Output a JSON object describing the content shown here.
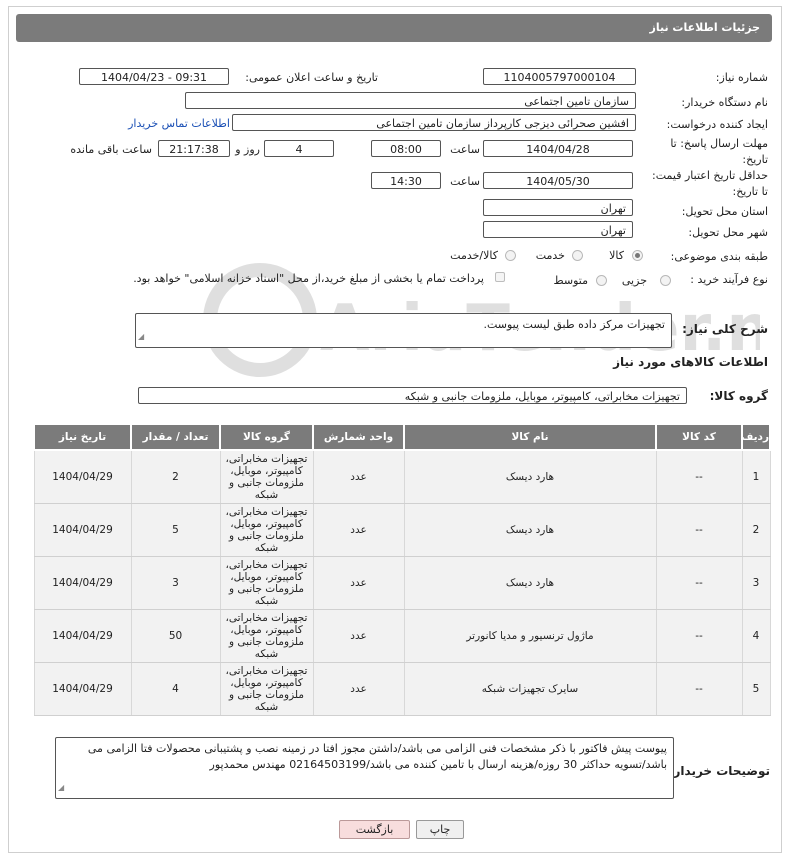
{
  "header": {
    "title": "جزئیات اطلاعات نیاز"
  },
  "form": {
    "need_number_label": "شماره نیاز:",
    "need_number": "1104005797000104",
    "announce_label": "تاریخ و ساعت اعلان عمومی:",
    "announce_value": "1404/04/23 - 09:31",
    "buyer_org_label": "نام دستگاه خریدار:",
    "buyer_org": "سازمان تامین اجتماعی",
    "creator_label": "ایجاد کننده درخواست:",
    "creator": "افشین صحرائی دیزجی کارپرداز سازمان تامین اجتماعی",
    "contact_link": "اطلاعات تماس خریدار",
    "deadline_label": "مهلت ارسال پاسخ: تا تاریخ:",
    "deadline_date": "1404/04/28",
    "time_label": "ساعت",
    "deadline_time": "08:00",
    "days_value": "4",
    "days_label": "روز و",
    "remaining_time": "21:17:38",
    "remaining_label": "ساعت باقی مانده",
    "validity_label": "حداقل تاریخ اعتبار قیمت: تا تاریخ:",
    "validity_date": "1404/05/30",
    "validity_time": "14:30",
    "province_label": "استان محل تحویل:",
    "province": "تهران",
    "city_label": "شهر محل تحویل:",
    "city": "تهران",
    "category_label": "طبقه بندی موضوعی:",
    "category_options": [
      "کالا",
      "خدمت",
      "کالا/خدمت"
    ],
    "category_selected": "کالا",
    "process_label": "نوع فرآیند خرید :",
    "process_options": [
      "جزیی",
      "متوسط"
    ],
    "payment_note": "پرداخت تمام یا بخشی از مبلغ خرید،از محل \"اسناد خزانه اسلامی\" خواهد بود.",
    "description_label": "شرح کلی نیاز:",
    "description": "تجهیزات مرکز داده طبق لیست پیوست.",
    "goods_info_title": "اطلاعات کالاهای مورد نیاز",
    "goods_group_label": "گروه کالا:",
    "goods_group": "تجهیزات مخابراتی، کامپیوتر، موبایل، ملزومات جانبی و شبکه"
  },
  "table": {
    "headers": [
      "ردیف",
      "کد کالا",
      "نام کالا",
      "واحد شمارش",
      "گروه کالا",
      "تعداد / مقدار",
      "تاریخ نیاز"
    ],
    "rows": [
      [
        "1",
        "--",
        "هارد دیسک",
        "عدد",
        "تجهیزات مخابراتی، کامپیوتر، موبایل، ملزومات جانبی و شبکه",
        "2",
        "1404/04/29"
      ],
      [
        "2",
        "--",
        "هارد دیسک",
        "عدد",
        "تجهیزات مخابراتی، کامپیوتر، موبایل، ملزومات جانبی و شبکه",
        "5",
        "1404/04/29"
      ],
      [
        "3",
        "--",
        "هارد دیسک",
        "عدد",
        "تجهیزات مخابراتی، کامپیوتر، موبایل، ملزومات جانبی و شبکه",
        "3",
        "1404/04/29"
      ],
      [
        "4",
        "--",
        "ماژول ترنسیور و مدیا کانورتر",
        "عدد",
        "تجهیزات مخابراتی، کامپیوتر، موبایل، ملزومات جانبی و شبکه",
        "50",
        "1404/04/29"
      ],
      [
        "5",
        "--",
        "سایرک تجهیزات شبکه",
        "عدد",
        "تجهیزات مخابراتی، کامپیوتر، موبایل، ملزومات جانبی و شبکه",
        "4",
        "1404/04/29"
      ]
    ]
  },
  "buyer_notes": {
    "label": "توضیحات خریدار:",
    "text": "پیوست پیش فاکتور با ذکر مشخصات فنی الزامی می باشد/داشتن مجوز افتا در زمینه نصب و پشتیبانی محصولات فتا الزامی می باشد/تسویه حداکثر 30 روزه/هزینه ارسال با تامین کننده می باشد/02164503199 مهندس محمدپور"
  },
  "buttons": {
    "print": "چاپ",
    "back": "بازگشت"
  },
  "watermark": "AriaTender.net"
}
